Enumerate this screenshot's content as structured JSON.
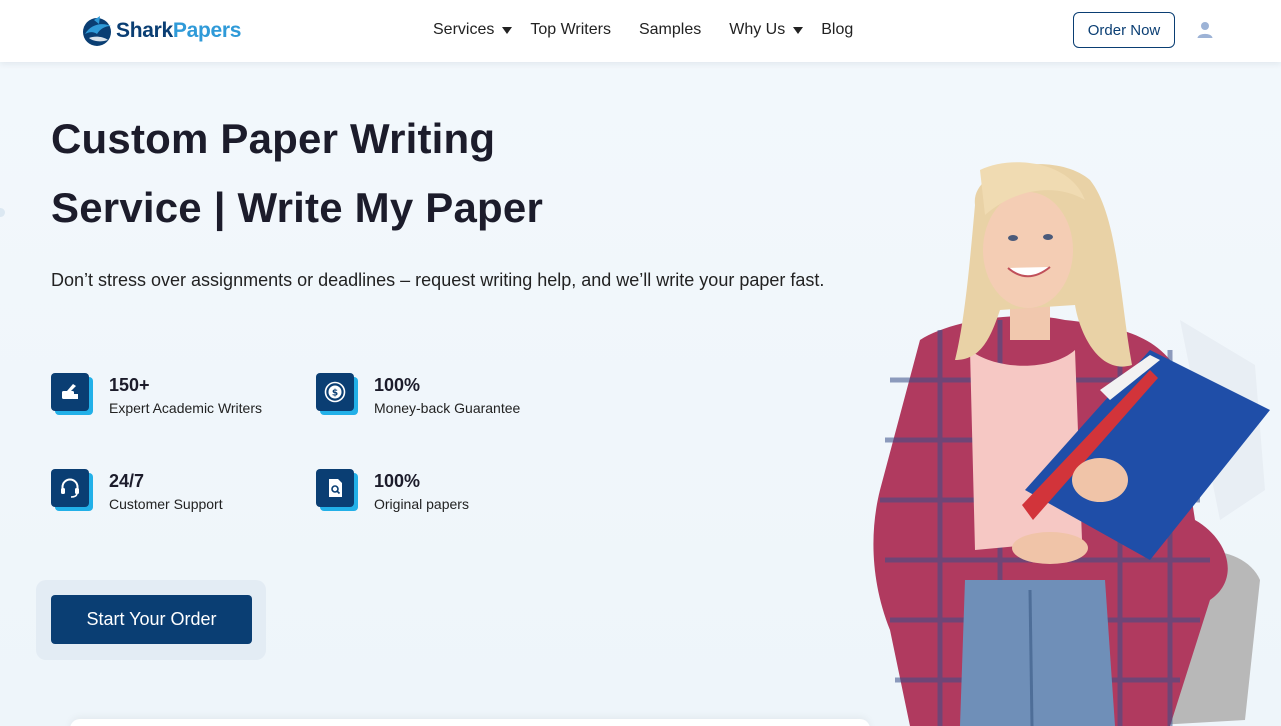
{
  "header": {
    "logo": {
      "part1": "Shark",
      "part2": "Papers",
      "mark": "shark-logo-icon"
    },
    "nav": [
      {
        "label": "Services",
        "dropdown": true
      },
      {
        "label": "Top Writers",
        "dropdown": false
      },
      {
        "label": "Samples",
        "dropdown": false
      },
      {
        "label": "Why Us",
        "dropdown": true
      },
      {
        "label": "Blog",
        "dropdown": false
      }
    ],
    "order_button": "Order Now",
    "user_icon": "user-icon"
  },
  "hero": {
    "title_line1": "Custom Paper Writing",
    "title_line2": "Service | Write My Paper",
    "subtitle": "Don’t stress over assignments or deadlines – request writing help, and we’ll write your paper fast.",
    "features": [
      {
        "value": "150+",
        "label": "Expert Academic Writers",
        "icon": "writer-hand-icon"
      },
      {
        "value": "100%",
        "label": "Money-back Guarantee",
        "icon": "money-back-icon"
      },
      {
        "value": "24/7",
        "label": "Customer Support",
        "icon": "headset-icon"
      },
      {
        "value": "100%",
        "label": "Original papers",
        "icon": "document-search-icon"
      }
    ],
    "cta": "Start Your Order",
    "image": "student-with-folders-photo"
  },
  "colors": {
    "brand_dark": "#0a3e73",
    "brand_light": "#22b0e8",
    "background": "#f3f8fc"
  }
}
